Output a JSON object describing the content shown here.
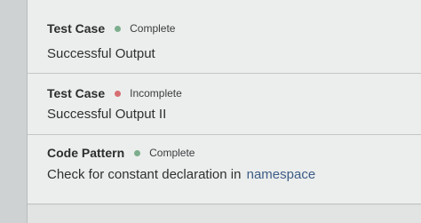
{
  "checks": [
    {
      "title": "Test Case",
      "status": "Complete",
      "status_color": "#7cae8d",
      "description": "Successful Output"
    },
    {
      "title": "Test Case",
      "status": "Incomplete",
      "status_color": "#d66f72",
      "description": "Successful Output II"
    },
    {
      "title": "Code Pattern",
      "status": "Complete",
      "status_color": "#7cae8d",
      "description": "Check for constant declaration in",
      "code_token": "namespace"
    }
  ]
}
